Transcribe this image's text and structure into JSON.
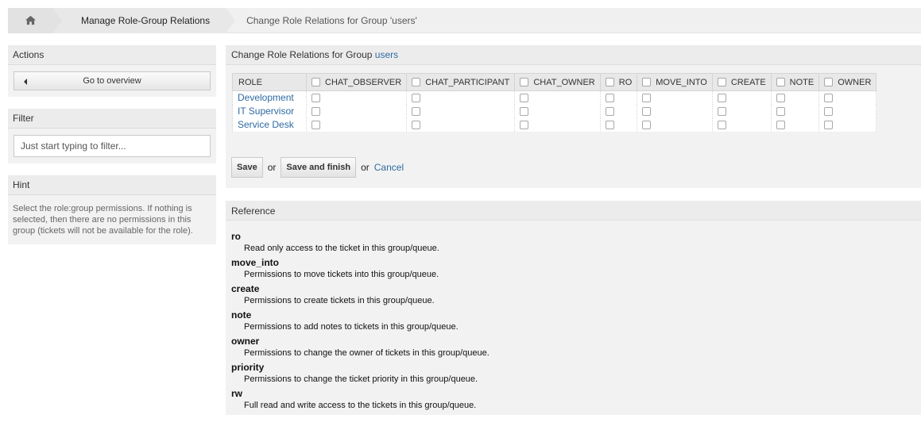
{
  "breadcrumb": {
    "home_icon": "home-icon",
    "items": [
      "Manage Role-Group Relations",
      "Change Role Relations for Group 'users'"
    ]
  },
  "sidebar": {
    "actions": {
      "title": "Actions",
      "overview_label": "Go to overview"
    },
    "filter": {
      "title": "Filter",
      "placeholder": "Just start typing to filter..."
    },
    "hint": {
      "title": "Hint",
      "text": "Select the role:group permissions. If nothing is selected, then there are no permissions in this group (tickets will not be available for the role)."
    }
  },
  "main": {
    "title_prefix": "Change Role Relations for Group",
    "title_group": "users",
    "table": {
      "role_header": "ROLE",
      "columns": [
        "CHAT_OBSERVER",
        "CHAT_PARTICIPANT",
        "CHAT_OWNER",
        "RO",
        "MOVE_INTO",
        "CREATE",
        "NOTE",
        "OWNER"
      ],
      "rows": [
        "Development",
        "IT Supervisor",
        "Service Desk"
      ]
    },
    "actions": {
      "save": "Save",
      "or1": "or",
      "save_finish": "Save and finish",
      "or2": "or",
      "cancel": "Cancel"
    }
  },
  "reference": {
    "title": "Reference",
    "items": [
      {
        "term": "ro",
        "desc": "Read only access to the ticket in this group/queue."
      },
      {
        "term": "move_into",
        "desc": "Permissions to move tickets into this group/queue."
      },
      {
        "term": "create",
        "desc": "Permissions to create tickets in this group/queue."
      },
      {
        "term": "note",
        "desc": "Permissions to add notes to tickets in this group/queue."
      },
      {
        "term": "owner",
        "desc": "Permissions to change the owner of tickets in this group/queue."
      },
      {
        "term": "priority",
        "desc": "Permissions to change the ticket priority in this group/queue."
      },
      {
        "term": "rw",
        "desc": "Full read and write access to the tickets in this group/queue."
      }
    ]
  }
}
